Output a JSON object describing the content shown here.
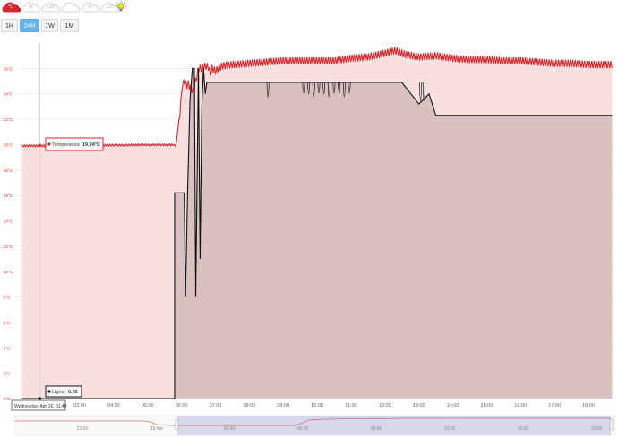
{
  "sensors": [
    {
      "icon": "temperature-cloud-icon",
      "label": "°C",
      "active": true,
      "color": "#d9262c"
    },
    {
      "icon": "humidity-cloud-icon",
      "label": "%",
      "active": false
    },
    {
      "icon": "co2-cloud-icon",
      "label": "CO₂",
      "active": false
    },
    {
      "icon": "pressure-cloud-icon",
      "label": "",
      "active": false
    },
    {
      "icon": "voc-cloud-icon",
      "label": "%",
      "active": false
    },
    {
      "icon": "co-cloud-icon",
      "label": "CO",
      "active": false
    },
    {
      "icon": "light-bulb-icon",
      "label": "",
      "active": false
    }
  ],
  "ranges": [
    {
      "label": "1H",
      "active": false
    },
    {
      "label": "24H",
      "active": true
    },
    {
      "label": "1W",
      "active": false
    },
    {
      "label": "1M",
      "active": false
    }
  ],
  "tooltip_temperature": {
    "name": "Temperature",
    "value": "19.94°C"
  },
  "tooltip_lights": {
    "name": "Lights",
    "value": "0.00"
  },
  "crosshair_label": "Wednesday, Apr 16, 01:49",
  "colors": {
    "temperature": "#d9262c",
    "temperature_fill": "#f8e0e0",
    "lights": "#111111",
    "lights_fill": "#d9c1c2",
    "navigator": "#c9cde6"
  },
  "chart_data": {
    "type": "area",
    "x_unit": "time",
    "x_ticks": [
      "03:00",
      "04:00",
      "05:00",
      "06:00",
      "07:00",
      "08:00",
      "09:00",
      "10:00",
      "11:00",
      "12:00",
      "13:00",
      "14:00",
      "15:00",
      "16:00",
      "17:00",
      "18:00"
    ],
    "y_ticks": [
      "0°C",
      "2°C",
      "4°C",
      "6°C",
      "8°C",
      "10°C",
      "12°C",
      "14°C",
      "16°C",
      "18°C",
      "20°C",
      "22°C",
      "24°C",
      "26°C"
    ],
    "ylim": [
      0,
      26.5
    ],
    "series": [
      {
        "name": "Temperature",
        "x": [
          1.3,
          1.8,
          2.5,
          3.0,
          4.0,
          5.0,
          5.7,
          5.75,
          5.8,
          5.85,
          5.9,
          5.95,
          6.0,
          6.05,
          6.1,
          6.15,
          6.2,
          6.25,
          6.35,
          6.5,
          6.6,
          6.7,
          6.8,
          6.85,
          6.9,
          7.0,
          7.2,
          7.5,
          8.0,
          8.5,
          9.0,
          9.5,
          10.0,
          10.5,
          11.0,
          11.5,
          12.0,
          12.3,
          12.6,
          13.0,
          13.5,
          14.0,
          14.5,
          15.0,
          15.5,
          16.0,
          16.5,
          17.0,
          17.5,
          18.0,
          18.7
        ],
        "y": [
          19.9,
          19.9,
          19.94,
          19.95,
          19.95,
          19.98,
          19.98,
          20.0,
          19.9,
          20.1,
          21.5,
          22.2,
          24.2,
          24.8,
          25.0,
          24.6,
          24.8,
          24.5,
          24.2,
          26.0,
          26.0,
          26.2,
          26.1,
          25.6,
          26.0,
          25.8,
          26.2,
          26.3,
          26.4,
          26.5,
          26.6,
          26.6,
          26.6,
          26.6,
          26.8,
          26.9,
          27.2,
          27.4,
          27.1,
          26.9,
          27.0,
          26.8,
          26.7,
          26.7,
          26.6,
          26.6,
          26.5,
          26.4,
          26.4,
          26.3,
          26.3
        ]
      },
      {
        "name": "Lights",
        "x": [
          1.3,
          3.0,
          4.0,
          5.0,
          5.8,
          5.8,
          6.0,
          6.08,
          6.12,
          6.18,
          6.25,
          6.32,
          6.38,
          6.42,
          6.5,
          6.55,
          6.6,
          6.65,
          6.7,
          6.75,
          6.8,
          6.85,
          6.9,
          7.0,
          7.5,
          8.0,
          8.5,
          9.5,
          10.0,
          10.5,
          11.0,
          11.5,
          12.0,
          12.5,
          13.0,
          13.3,
          13.5,
          14.0,
          15.0,
          16.0,
          17.0,
          18.0,
          18.7
        ],
        "y": [
          0,
          0,
          0,
          0,
          0,
          16.2,
          16.2,
          16.2,
          8.0,
          16.2,
          23.5,
          26.0,
          26.0,
          8.0,
          26.0,
          11.0,
          23.0,
          26.0,
          24.0,
          24.9,
          24.9,
          24.9,
          24.9,
          24.9,
          24.9,
          24.9,
          24.9,
          24.9,
          24.9,
          24.9,
          24.9,
          24.9,
          24.9,
          24.9,
          23.2,
          24.0,
          22.3,
          22.3,
          22.3,
          22.3,
          22.3,
          22.3,
          22.3
        ]
      }
    ],
    "crosshair_x": 1.82,
    "grid": true
  }
}
